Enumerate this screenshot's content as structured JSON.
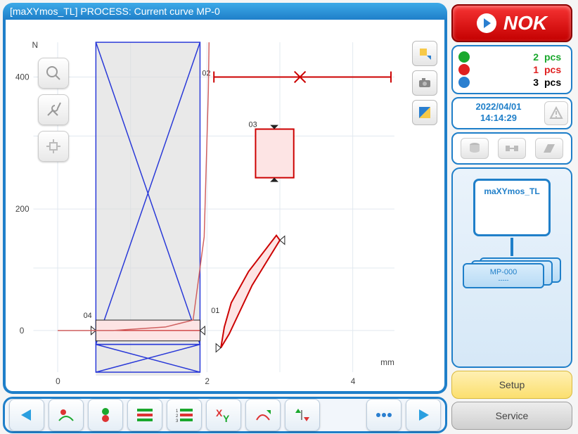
{
  "title": "[maXYmos_TL] PROCESS: Current curve MP-0",
  "axes": {
    "x_label": "mm",
    "y_label": "N"
  },
  "ticks": {
    "x": [
      "0",
      "2",
      "4"
    ],
    "y": [
      "0",
      "200",
      "400"
    ]
  },
  "eo_labels": {
    "eo01": "01",
    "eo02": "02",
    "eo03": "03",
    "eo04": "04"
  },
  "status": {
    "label": "NOK"
  },
  "counts": {
    "ok": {
      "value": "2",
      "unit": "pcs",
      "color": "#1aa82d"
    },
    "nok": {
      "value": "1",
      "unit": "pcs",
      "color": "#e02020"
    },
    "total": {
      "value": "3",
      "unit": "pcs",
      "color": "#000"
    }
  },
  "datetime": {
    "date": "2022/04/01",
    "time": "14:14:29"
  },
  "device": {
    "name": "maXYmos_TL",
    "mp_label": "MP-000",
    "mp_sub": "-----"
  },
  "buttons": {
    "setup": "Setup",
    "service": "Service"
  },
  "chart_data": {
    "type": "line",
    "xlabel": "mm",
    "ylabel": "N",
    "xlim": [
      -0.5,
      5
    ],
    "ylim": [
      -70,
      440
    ],
    "x_ticks": [
      0,
      2,
      4
    ],
    "y_ticks": [
      0,
      200,
      400
    ],
    "series": [
      {
        "name": "curve",
        "x": [
          0,
          0.8,
          1.5,
          1.9,
          2.05,
          2.1,
          2.1
        ],
        "y": [
          0,
          0,
          5,
          20,
          150,
          380,
          440
        ]
      }
    ],
    "envelope_01": {
      "x": [
        2.2,
        2.35,
        2.7,
        2.95,
        2.85,
        2.5,
        2.35,
        2.25,
        2.2
      ],
      "y": [
        -50,
        -25,
        70,
        130,
        135,
        55,
        0,
        -25,
        -50
      ]
    },
    "evaluation_objects": [
      {
        "id": "02",
        "type": "uni-line-x",
        "x_range": [
          2.1,
          4.5
        ],
        "y": 400,
        "ref_x": 3.25
      },
      {
        "id": "03",
        "type": "box",
        "x_range": [
          2.7,
          3.1
        ],
        "y_range": [
          225,
          320
        ]
      },
      {
        "id": "04",
        "type": "threshold-band",
        "x_range": [
          0.85,
          2.0
        ],
        "y_range": [
          -5,
          20
        ]
      },
      {
        "id": "01",
        "type": "entry-marker",
        "x": 2.2,
        "y": -25
      }
    ],
    "masked_region": {
      "x_range": [
        0.9,
        2.0
      ],
      "y_range": [
        -70,
        440
      ]
    }
  }
}
